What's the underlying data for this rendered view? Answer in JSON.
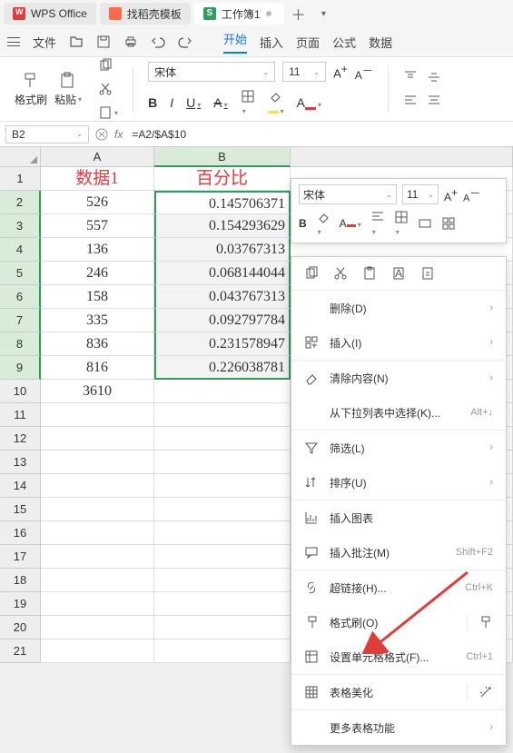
{
  "tabs": {
    "wps": "WPS Office",
    "dk": "找稻壳模板",
    "s": "工作簿1"
  },
  "menu": {
    "file": "文件",
    "start": "开始",
    "insert": "插入",
    "page": "页面",
    "formula": "公式",
    "data": "数据"
  },
  "ribbon": {
    "brush": "格式刷",
    "paste": "粘贴",
    "font": "宋体",
    "fontsize": "11"
  },
  "formula": {
    "name": "B2",
    "value": "=A2/$A$10"
  },
  "cols": {
    "A": "A",
    "B": "B"
  },
  "rows": [
    "1",
    "2",
    "3",
    "4",
    "5",
    "6",
    "7",
    "8",
    "9",
    "10",
    "11",
    "12",
    "13",
    "14",
    "15",
    "16",
    "17",
    "18",
    "19",
    "20",
    "21"
  ],
  "data": {
    "A": [
      "数据1",
      "526",
      "557",
      "136",
      "246",
      "158",
      "335",
      "836",
      "816",
      "3610"
    ],
    "B": [
      "百分比",
      "0.145706371",
      "0.154293629",
      "0.03767313",
      "0.068144044",
      "0.043767313",
      "0.092797784",
      "0.231578947",
      "0.226038781"
    ]
  },
  "floattb": {
    "font": "宋体",
    "size": "11"
  },
  "ctx": {
    "delete": "删除(D)",
    "insert": "插入(I)",
    "clear": "清除内容(N)",
    "droplist": "从下拉列表中选择(K)...",
    "droplist_k": "Alt+↓",
    "filter": "筛选(L)",
    "sort": "排序(U)",
    "chart": "插入图表",
    "comment": "插入批注(M)",
    "comment_k": "Shift+F2",
    "link": "超链接(H)...",
    "link_k": "Ctrl+K",
    "brush": "格式刷(O)",
    "cellfmt": "设置单元格格式(F)...",
    "cellfmt_k": "Ctrl+1",
    "beautify": "表格美化",
    "more": "更多表格功能"
  }
}
